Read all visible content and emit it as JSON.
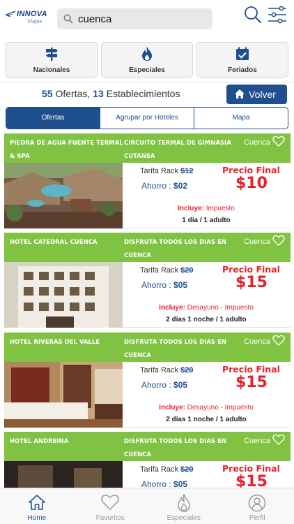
{
  "header": {
    "logo_text": "INNOVA",
    "logo_sub": "Viajes",
    "search_value": "cuenca"
  },
  "categories": [
    {
      "label": "Nacionales",
      "icon": "signpost-icon"
    },
    {
      "label": "Especiales",
      "icon": "flame-icon"
    },
    {
      "label": "Feriados",
      "icon": "calendar-check-icon"
    }
  ],
  "summary": {
    "ofertas_count": "55",
    "ofertas_label": " Ofertas, ",
    "estab_count": "13",
    "estab_label": " Establecimientos"
  },
  "volver_label": "Volver",
  "segments": [
    "Ofertas",
    "Agrupar por Hoteles",
    "Mapa"
  ],
  "common": {
    "tarifa_label": "Tarifa Rack ",
    "ahorro_label": "Ahorro : ",
    "precio_final_label": "Precio Final",
    "incluye_label": "Incluye: "
  },
  "offers": [
    {
      "hotel": "PIEDRA DE AGUA FUENTE TERMAL & SPA",
      "desc": "CIRCUITO TERMAL DE GIMNASIA CUTANEA",
      "city": "Cuenca",
      "rack": "$12",
      "ahorro": "$02",
      "price": "$10",
      "incluye": "Impuesto",
      "duracion": "1 día / 1 adulto"
    },
    {
      "hotel": "HOTEL CATEDRAL CUENCA",
      "desc": "DISFRUTA TODOS LOS DIAS EN CUENCA",
      "city": "Cuenca",
      "rack": "$20",
      "ahorro": "$05",
      "price": "$15",
      "incluye": "Desayuno - Impuesto",
      "duracion": "2 días 1 noche / 1 adulto"
    },
    {
      "hotel": "HOTEL RIVERAS DEL VALLE",
      "desc": "DISFRUTA TODOS LOS DIAS EN CUENCA",
      "city": "Cuenca",
      "rack": "$20",
      "ahorro": "$05",
      "price": "$15",
      "incluye": "Desayuno - Impuesto",
      "duracion": "2 días 1 noche / 1 adulto"
    },
    {
      "hotel": "HOTEL ANDREINA",
      "desc": "DISFRUTA TODOS LOS DIAS EN CUENCA",
      "city": "Cuenca",
      "rack": "$20",
      "ahorro": "$05",
      "price": "$15",
      "incluye": "",
      "duracion": ""
    }
  ],
  "tabs": [
    {
      "label": "Home",
      "icon": "home-icon",
      "active": true
    },
    {
      "label": "Favoritos",
      "icon": "heart-icon",
      "active": false
    },
    {
      "label": "Especiales",
      "icon": "flame-icon",
      "active": false
    },
    {
      "label": "Perfil",
      "icon": "user-icon",
      "active": false
    }
  ],
  "colors": {
    "brand_blue": "#1f4f8f",
    "offer_green": "#80c241",
    "price_red": "#e5212b"
  }
}
